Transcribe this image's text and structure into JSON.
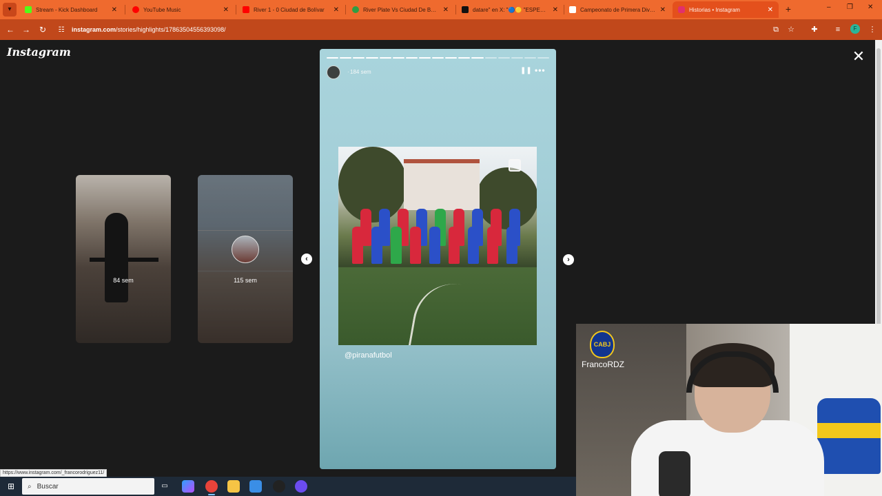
{
  "browser": {
    "tabs": [
      {
        "title": "Stream - Kick Dashboard",
        "color": "#53fc18"
      },
      {
        "title": "YouTube Music",
        "color": "#ff0000"
      },
      {
        "title": "River 1 - 0 Ciudad de Bolívar",
        "color": "#ff0000"
      },
      {
        "title": "River Plate Vs Ciudad De Bolívar",
        "color": "#2f9e44"
      },
      {
        "title": "datare\" en X: \"🔵🟡 \"ESPERAN",
        "color": "#111111"
      },
      {
        "title": "Campeonato de Primera División",
        "color": "#ffffff"
      },
      {
        "title": "Historias • Instagram",
        "color": "#e1306c",
        "active": true
      }
    ],
    "new_tab": "+",
    "window_controls": {
      "minimize": "–",
      "restore": "❐",
      "close": "✕"
    },
    "url_host": "instagram.com",
    "url_path": "/stories/highlights/17863504556393098/"
  },
  "instagram": {
    "logo": "Instagram",
    "close": "✕",
    "prev_thumb_label": "84 sem",
    "next_thumb_label": "115 sem",
    "prev_arrow": "‹",
    "next_arrow": "›",
    "story": {
      "progress_total": 17,
      "progress_done": 12,
      "dot": "·",
      "age": "184 sem",
      "pause_icon": "❚❚",
      "more_icon": "•••",
      "mention": "@piranafutbol"
    }
  },
  "overlay": {
    "username": "FrancoRDZ",
    "crest_text": "CABJ"
  },
  "status_url": "https://www.instagram.com/_francorodriguez11/",
  "taskbar": {
    "search_placeholder": "Buscar"
  }
}
